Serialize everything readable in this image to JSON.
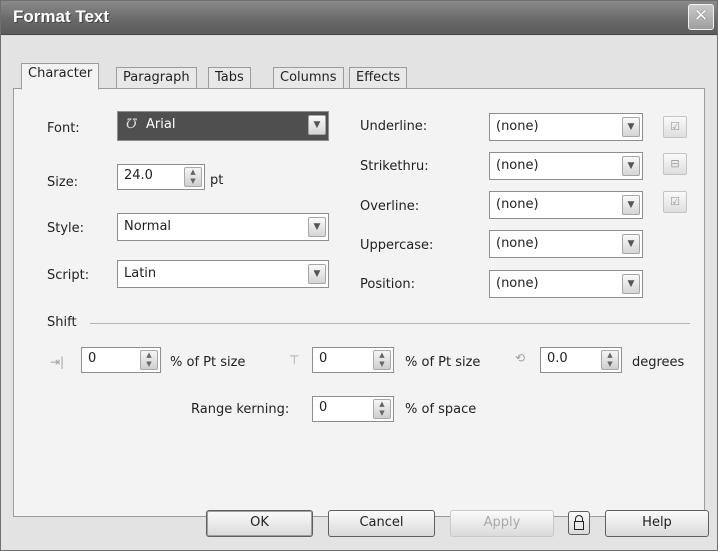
{
  "window": {
    "title": "Format Text",
    "close_glyph": "✕"
  },
  "tabs": [
    {
      "label": "Character",
      "active": true
    },
    {
      "label": "Paragraph",
      "active": false
    },
    {
      "label": "Tabs",
      "active": false
    },
    {
      "label": "Columns",
      "active": false
    },
    {
      "label": "Effects",
      "active": false
    }
  ],
  "character": {
    "font_label": "Font:",
    "font_value": "Arial",
    "size_label": "Size:",
    "size_value": "24.0",
    "size_unit": "pt",
    "style_label": "Style:",
    "style_value": "Normal",
    "script_label": "Script:",
    "script_value": "Latin",
    "underline_label": "Underline:",
    "underline_value": "(none)",
    "strikethru_label": "Strikethru:",
    "strikethru_value": "(none)",
    "overline_label": "Overline:",
    "overline_value": "(none)",
    "uppercase_label": "Uppercase:",
    "uppercase_value": "(none)",
    "position_label": "Position:",
    "position_value": "(none)"
  },
  "shift": {
    "label": "Shift",
    "horizontal_value": "0",
    "horizontal_unit": "% of Pt size",
    "vertical_value": "0",
    "vertical_unit": "% of Pt size",
    "angle_value": "0.0",
    "angle_unit": "degrees",
    "kerning_label": "Range kerning:",
    "kerning_value": "0",
    "kerning_unit": "% of space"
  },
  "buttons": {
    "ok": "OK",
    "cancel": "Cancel",
    "apply": "Apply",
    "help": "Help"
  },
  "icons": {
    "font_type_icon": "truetype-font-icon",
    "dropdown_arrow": "▼",
    "spin_up": "▲",
    "spin_down": "▼",
    "underline_edit": "edit-underline-icon",
    "strikethru_edit": "edit-strikethru-icon",
    "overline_edit": "edit-overline-icon",
    "h_shift": "horizontal-shift-icon",
    "v_shift": "vertical-shift-icon",
    "rotate": "character-angle-icon",
    "lock": "lock-icon"
  }
}
